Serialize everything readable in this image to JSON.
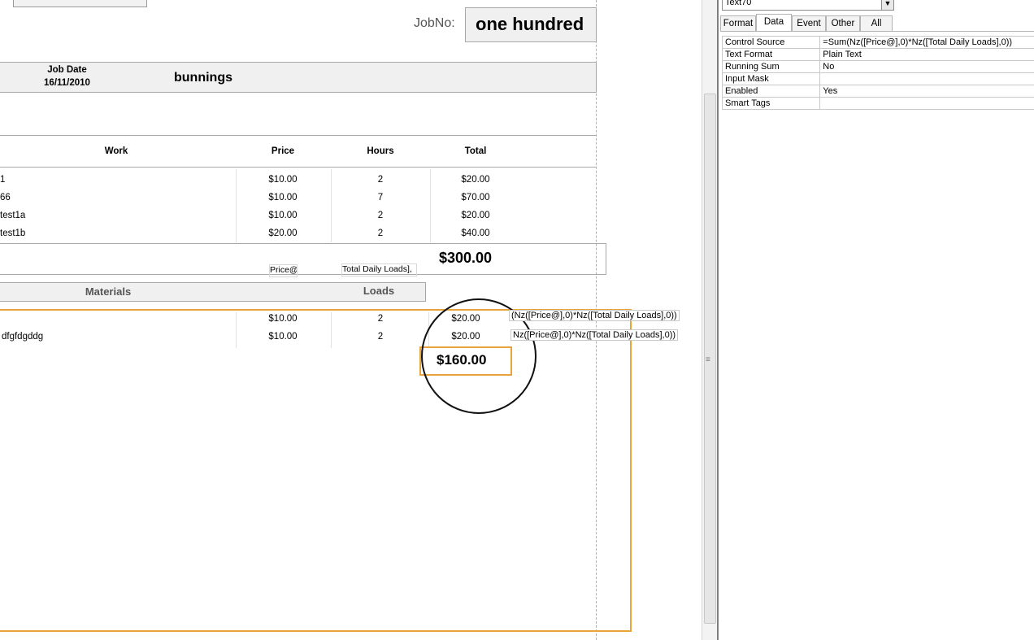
{
  "report": {
    "job_no_label": "JobNo:",
    "job_no_value": "one hundred",
    "job_date_label": "Job Date",
    "job_date_value": "16/11/2010",
    "customer": "bunnings",
    "work_headers": {
      "work": "Work",
      "price": "Price",
      "hours": "Hours",
      "total": "Total"
    },
    "work_rows": [
      {
        "work": "1",
        "price": "$10.00",
        "hours": "2",
        "total": "$20.00"
      },
      {
        "work": "66",
        "price": "$10.00",
        "hours": "7",
        "total": "$70.00"
      },
      {
        "work": "test1a",
        "price": "$10.00",
        "hours": "2",
        "total": "$20.00"
      },
      {
        "work": "test1b",
        "price": "$20.00",
        "hours": "2",
        "total": "$40.00"
      }
    ],
    "work_grand_total": "$300.00",
    "footer_fields": {
      "price": "Price@",
      "loads": "Total Daily Loads],"
    },
    "materials_headers": {
      "materials": "Materials",
      "loads": "Loads"
    },
    "material_rows": [
      {
        "material": "",
        "price": "$10.00",
        "loads": "2",
        "total": "$20.00",
        "tip": "(Nz([Price@],0)*Nz([Total Daily Loads],0))"
      },
      {
        "material": "dfgfdgddg",
        "price": "$10.00",
        "loads": "2",
        "total": "$20.00",
        "tip": "Nz([Price@],0)*Nz([Total Daily Loads],0))"
      }
    ],
    "materials_total": "$160.00"
  },
  "property_sheet": {
    "selected_control": "Text70",
    "tabs": [
      "Format",
      "Data",
      "Event",
      "Other",
      "All"
    ],
    "active_tab": "Data",
    "properties": [
      {
        "name": "Control Source",
        "value": "=Sum(Nz([Price@],0)*Nz([Total Daily Loads],0))"
      },
      {
        "name": "Text Format",
        "value": "Plain Text"
      },
      {
        "name": "Running Sum",
        "value": "No"
      },
      {
        "name": "Input Mask",
        "value": ""
      },
      {
        "name": "Enabled",
        "value": "Yes"
      },
      {
        "name": "Smart Tags",
        "value": ""
      }
    ]
  },
  "colors": {
    "highlight": "#e8a33a",
    "band": "#f0f0f0",
    "border": "#a8a8a8"
  }
}
